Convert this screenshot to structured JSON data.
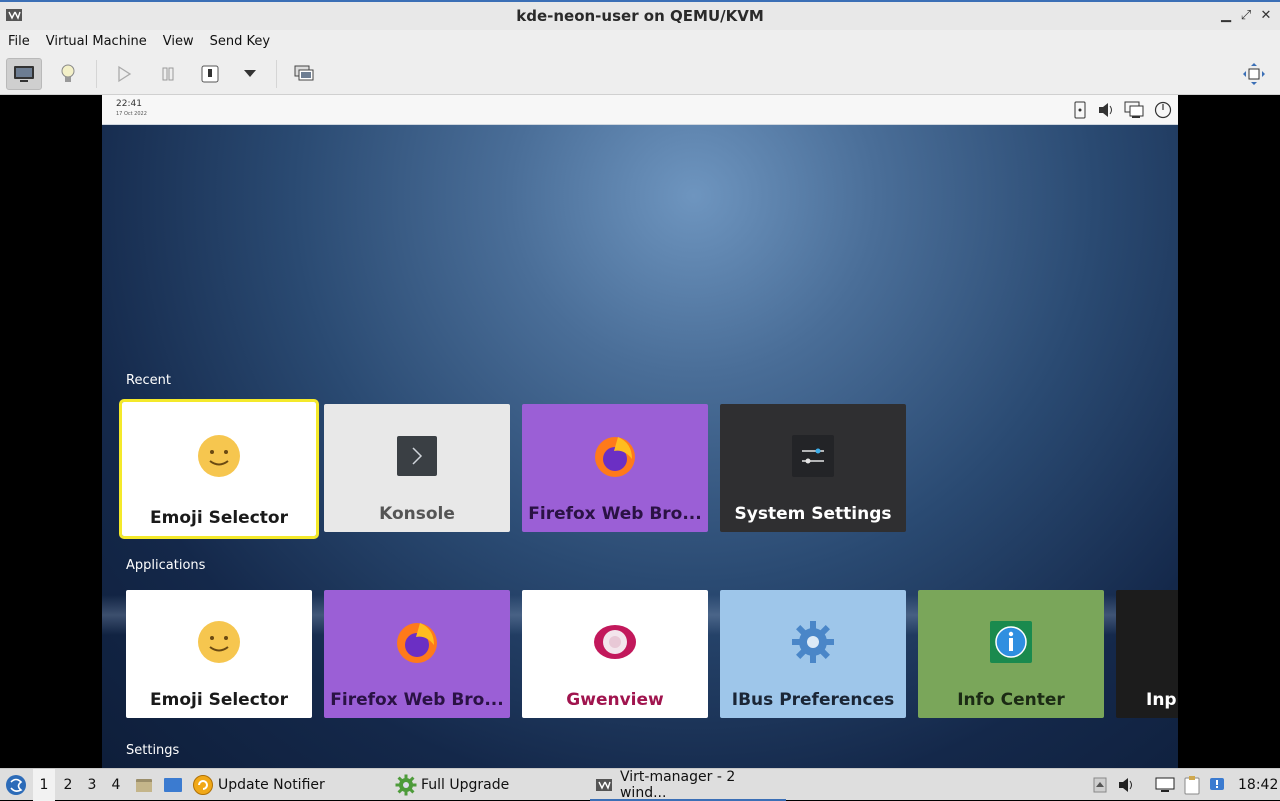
{
  "window": {
    "title": "kde-neon-user on QEMU/KVM"
  },
  "menu": {
    "items": [
      "File",
      "Virtual Machine",
      "View",
      "Send Key"
    ]
  },
  "guest": {
    "clock": {
      "time": "22:41",
      "date": "17 Oct 2022"
    },
    "sections": {
      "recent": {
        "label": "Recent",
        "tiles": [
          {
            "label": "Emoji Selector",
            "icon": "emoji-icon",
            "bg": "#ffffff",
            "fg": "#1a1a1a",
            "selected": true
          },
          {
            "label": "Konsole",
            "icon": "konsole-icon",
            "bg": "#e8e8e8",
            "fg": "#555555"
          },
          {
            "label": "Firefox Web Bro...",
            "icon": "firefox-icon",
            "bg": "#9b5fd6",
            "fg": "#2a1244"
          },
          {
            "label": "System Settings",
            "icon": "settings-sliders-icon",
            "bg": "#2f2f31",
            "fg": "#ffffff"
          }
        ]
      },
      "applications": {
        "label": "Applications",
        "tiles": [
          {
            "label": "Emoji Selector",
            "icon": "emoji-icon",
            "bg": "#ffffff",
            "fg": "#1a1a1a"
          },
          {
            "label": "Firefox Web Bro...",
            "icon": "firefox-icon",
            "bg": "#9b5fd6",
            "fg": "#2a1244"
          },
          {
            "label": "Gwenview",
            "icon": "gwenview-icon",
            "bg": "#ffffff",
            "fg": "#a0144e"
          },
          {
            "label": "IBus Preferences",
            "icon": "gear-icon",
            "bg": "#9ec6ea",
            "fg": "#1b2636"
          },
          {
            "label": "Info Center",
            "icon": "info-icon",
            "bg": "#7aa65a",
            "fg": "#1b2a14"
          },
          {
            "label": "Inp",
            "icon": "",
            "bg": "#1c1c1c",
            "fg": "#ffffff"
          }
        ]
      },
      "settings": {
        "label": "Settings"
      }
    }
  },
  "taskbar": {
    "workspaces": [
      "1",
      "2",
      "3",
      "4"
    ],
    "tasks": [
      {
        "label": "Update Notifier",
        "icon": "update-notifier-icon"
      },
      {
        "label": "Full Upgrade",
        "icon": "gear-icon"
      },
      {
        "label": "Virt-manager - 2 wind...",
        "icon": "virt-manager-icon"
      }
    ],
    "clock": "18:42"
  }
}
